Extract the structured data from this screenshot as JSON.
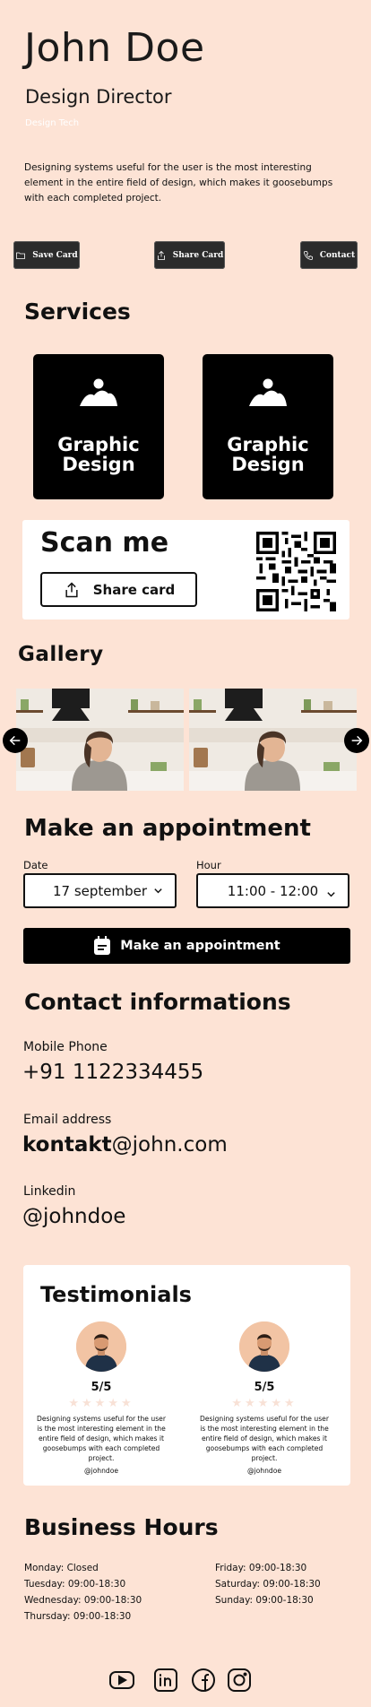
{
  "profile": {
    "name": "John Doe",
    "role": "Design Director",
    "company": "Design Tech",
    "bio": "Designing systems useful for the user is the most interesting element in the entire field of design, which makes it goosebumps with each completed project."
  },
  "actions": {
    "save": "Save Card",
    "share": "Share Card",
    "contact": "Contact"
  },
  "services": {
    "title": "Services",
    "items": [
      {
        "label": "Graphic\nDesign",
        "icon": "image-icon"
      },
      {
        "label": "Graphic\nDesign",
        "icon": "image-icon"
      }
    ]
  },
  "scan": {
    "title": "Scan me",
    "button": "Share card"
  },
  "gallery": {
    "title": "Gallery"
  },
  "appointment": {
    "title_light": "Make an",
    "title_bold": "appointment",
    "date_label": "Date",
    "date_value": "17 september",
    "hour_label": "Hour",
    "hour_value": "11:00 - 12:00",
    "button": "Make an appointment"
  },
  "contact": {
    "title": "Contact informations",
    "phone_label": "Mobile Phone",
    "phone": "+91 1122334455",
    "email_label": "Email address",
    "email_bold": "kontakt",
    "email_rest": "@john.com",
    "linkedin_label": "Linkedin",
    "linkedin": "@johndoe"
  },
  "testimonials": {
    "title": "Testimonials",
    "items": [
      {
        "rating": "5/5",
        "stars": "★★★★★",
        "text": "Designing systems useful for the user is the most interesting element in the entire field of design, which makes it goosebumps with each completed project.",
        "handle": "@johndoe"
      },
      {
        "rating": "5/5",
        "stars": "★★★★★",
        "text": "Designing systems useful for the user is the most interesting element in the entire field of design, which makes it goosebumps with each completed project.",
        "handle": "@johndoe"
      }
    ]
  },
  "hours": {
    "title": "Business Hours",
    "left": [
      "Monday: Closed",
      "Tuesday: 09:00-18:30",
      "Wednesday: 09:00-18:30",
      "Thursday: 09:00-18:30"
    ],
    "right": [
      "Friday: 09:00-18:30",
      "Saturday: 09:00-18:30",
      "Sunday: 09:00-18:30"
    ]
  },
  "social": [
    "youtube-icon",
    "linkedin-icon",
    "facebook-icon",
    "instagram-icon"
  ],
  "colors": {
    "background": "#fde3d5",
    "primary": "#000000",
    "card": "#ffffff"
  }
}
